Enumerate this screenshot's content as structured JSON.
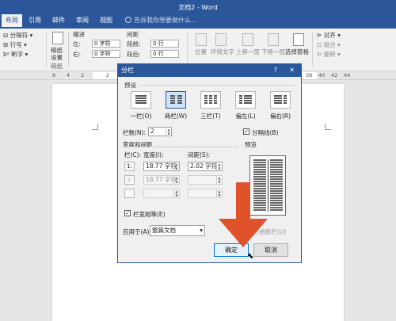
{
  "window": {
    "title": "文档2 - Word"
  },
  "tabs": [
    {
      "label": "布局",
      "active": true
    },
    {
      "label": "引用",
      "active": false
    },
    {
      "label": "邮件",
      "active": false
    },
    {
      "label": "审阅",
      "active": false
    },
    {
      "label": "视图",
      "active": false
    }
  ],
  "tell_me": "告诉我你想要做什么...",
  "ribbon": {
    "breaks": "分隔符",
    "line_numbers": "行号",
    "hyphenation": "断字",
    "draft_paper_1": "稿纸",
    "draft_paper_2": "设置",
    "draft_paper_group": "稿纸",
    "indent_title": "缩进",
    "indent_left_label": "左:",
    "indent_left_value": "0 字符",
    "indent_right_label": "右:",
    "indent_right_value": "0 字符",
    "spacing_title": "间距",
    "spacing_before_label": "段前:",
    "spacing_before_value": "0 行",
    "spacing_after_label": "段后:",
    "spacing_after_value": "0 行",
    "position": "位置",
    "wrap_text": "环绕文字",
    "bring_forward": "上移一层",
    "send_backward": "下移一层",
    "selection_pane": "选择窗格",
    "align": "对齐",
    "group": "组合",
    "rotate": "旋转"
  },
  "ruler": {
    "ticks": [
      "6",
      "4",
      "2",
      "2",
      "4",
      "6",
      "8",
      "10",
      "12",
      "14",
      "38",
      "40",
      "42",
      "44"
    ]
  },
  "dialog": {
    "title": "分栏",
    "help": "?",
    "close": "✕",
    "presets_label": "预设",
    "presets": [
      {
        "label": "一栏(O)",
        "selected": false
      },
      {
        "label": "两栏(W)",
        "selected": true
      },
      {
        "label": "三栏(T)",
        "selected": false
      },
      {
        "label": "偏左(L)",
        "selected": false
      },
      {
        "label": "偏右(R)",
        "selected": false
      }
    ],
    "num_columns_label": "栏数(N):",
    "num_columns_value": "2",
    "separator_label": "分隔线(B)",
    "separator_checked": true,
    "width_spacing_label": "宽度和间距",
    "col_header": "栏(C):",
    "width_header": "宽度(I):",
    "spacing_header": "间距(S):",
    "rows": [
      {
        "col": "1:",
        "width": "18.77 字符",
        "spacing": "2.02 字符",
        "enabled": true
      },
      {
        "col": "2:",
        "width": "18.77 字符",
        "spacing": "",
        "enabled": false
      },
      {
        "col": "",
        "width": "",
        "spacing": "",
        "enabled": false
      }
    ],
    "equal_width_label": "栏宽相等(E)",
    "equal_width_checked": true,
    "preview_label": "预览",
    "apply_to_label": "应用于(A):",
    "apply_to_value": "整篇文档",
    "new_column_label": "开始新栏(U)",
    "ok_label": "确定",
    "cancel_label": "取消"
  },
  "colors": {
    "accent": "#2b579a",
    "arrow": "#e0522a"
  }
}
